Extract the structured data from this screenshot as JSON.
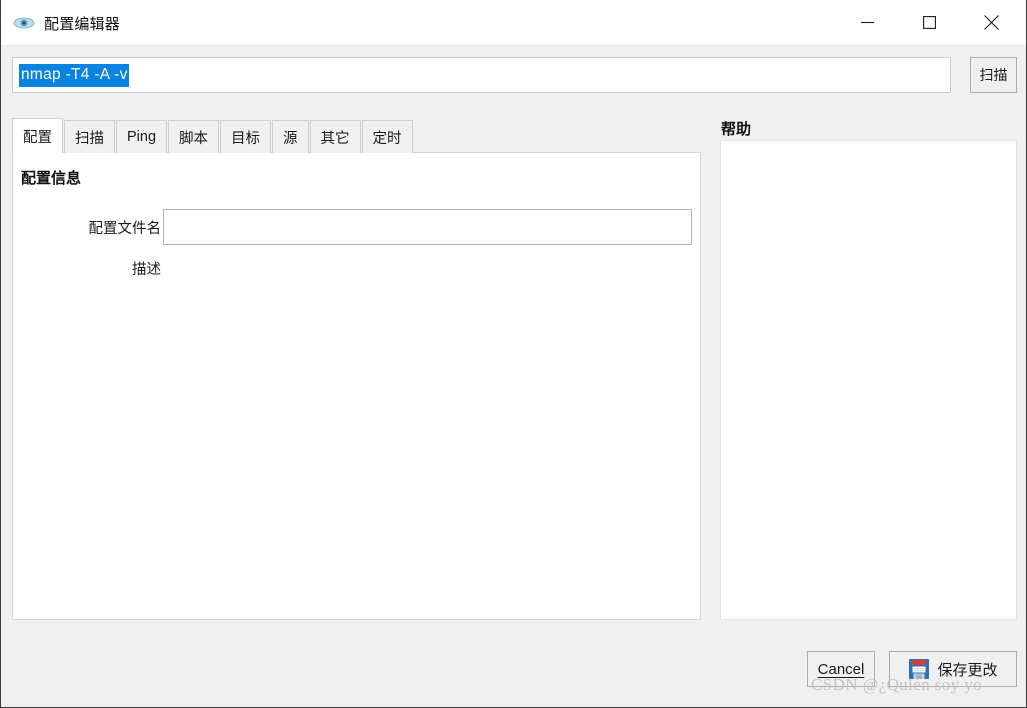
{
  "window": {
    "title": "配置编辑器",
    "icon": "eye-icon",
    "controls": {
      "minimize": "—",
      "maximize": "□",
      "close": "✕"
    }
  },
  "command_bar": {
    "value": "nmap -T4 -A -v",
    "selected": true,
    "selection_color": "#0a84e0",
    "scan_button_label": "扫描"
  },
  "tabs": [
    {
      "label": "配置",
      "active": true
    },
    {
      "label": "扫描",
      "active": false
    },
    {
      "label": "Ping",
      "active": false
    },
    {
      "label": "脚本",
      "active": false
    },
    {
      "label": "目标",
      "active": false
    },
    {
      "label": "源",
      "active": false
    },
    {
      "label": "其它",
      "active": false
    },
    {
      "label": "定时",
      "active": false
    }
  ],
  "profile_panel": {
    "section_title": "配置信息",
    "profile_name_label": "配置文件名",
    "profile_name_value": "",
    "profile_name_placeholder": "",
    "description_label": "描述"
  },
  "help_panel": {
    "title": "帮助",
    "content": ""
  },
  "footer": {
    "cancel_label": "Cancel",
    "save_label": "保存更改",
    "save_icon": "floppy-disk-icon"
  },
  "watermark": {
    "text": "CSDN @¿Quién soy yo"
  }
}
